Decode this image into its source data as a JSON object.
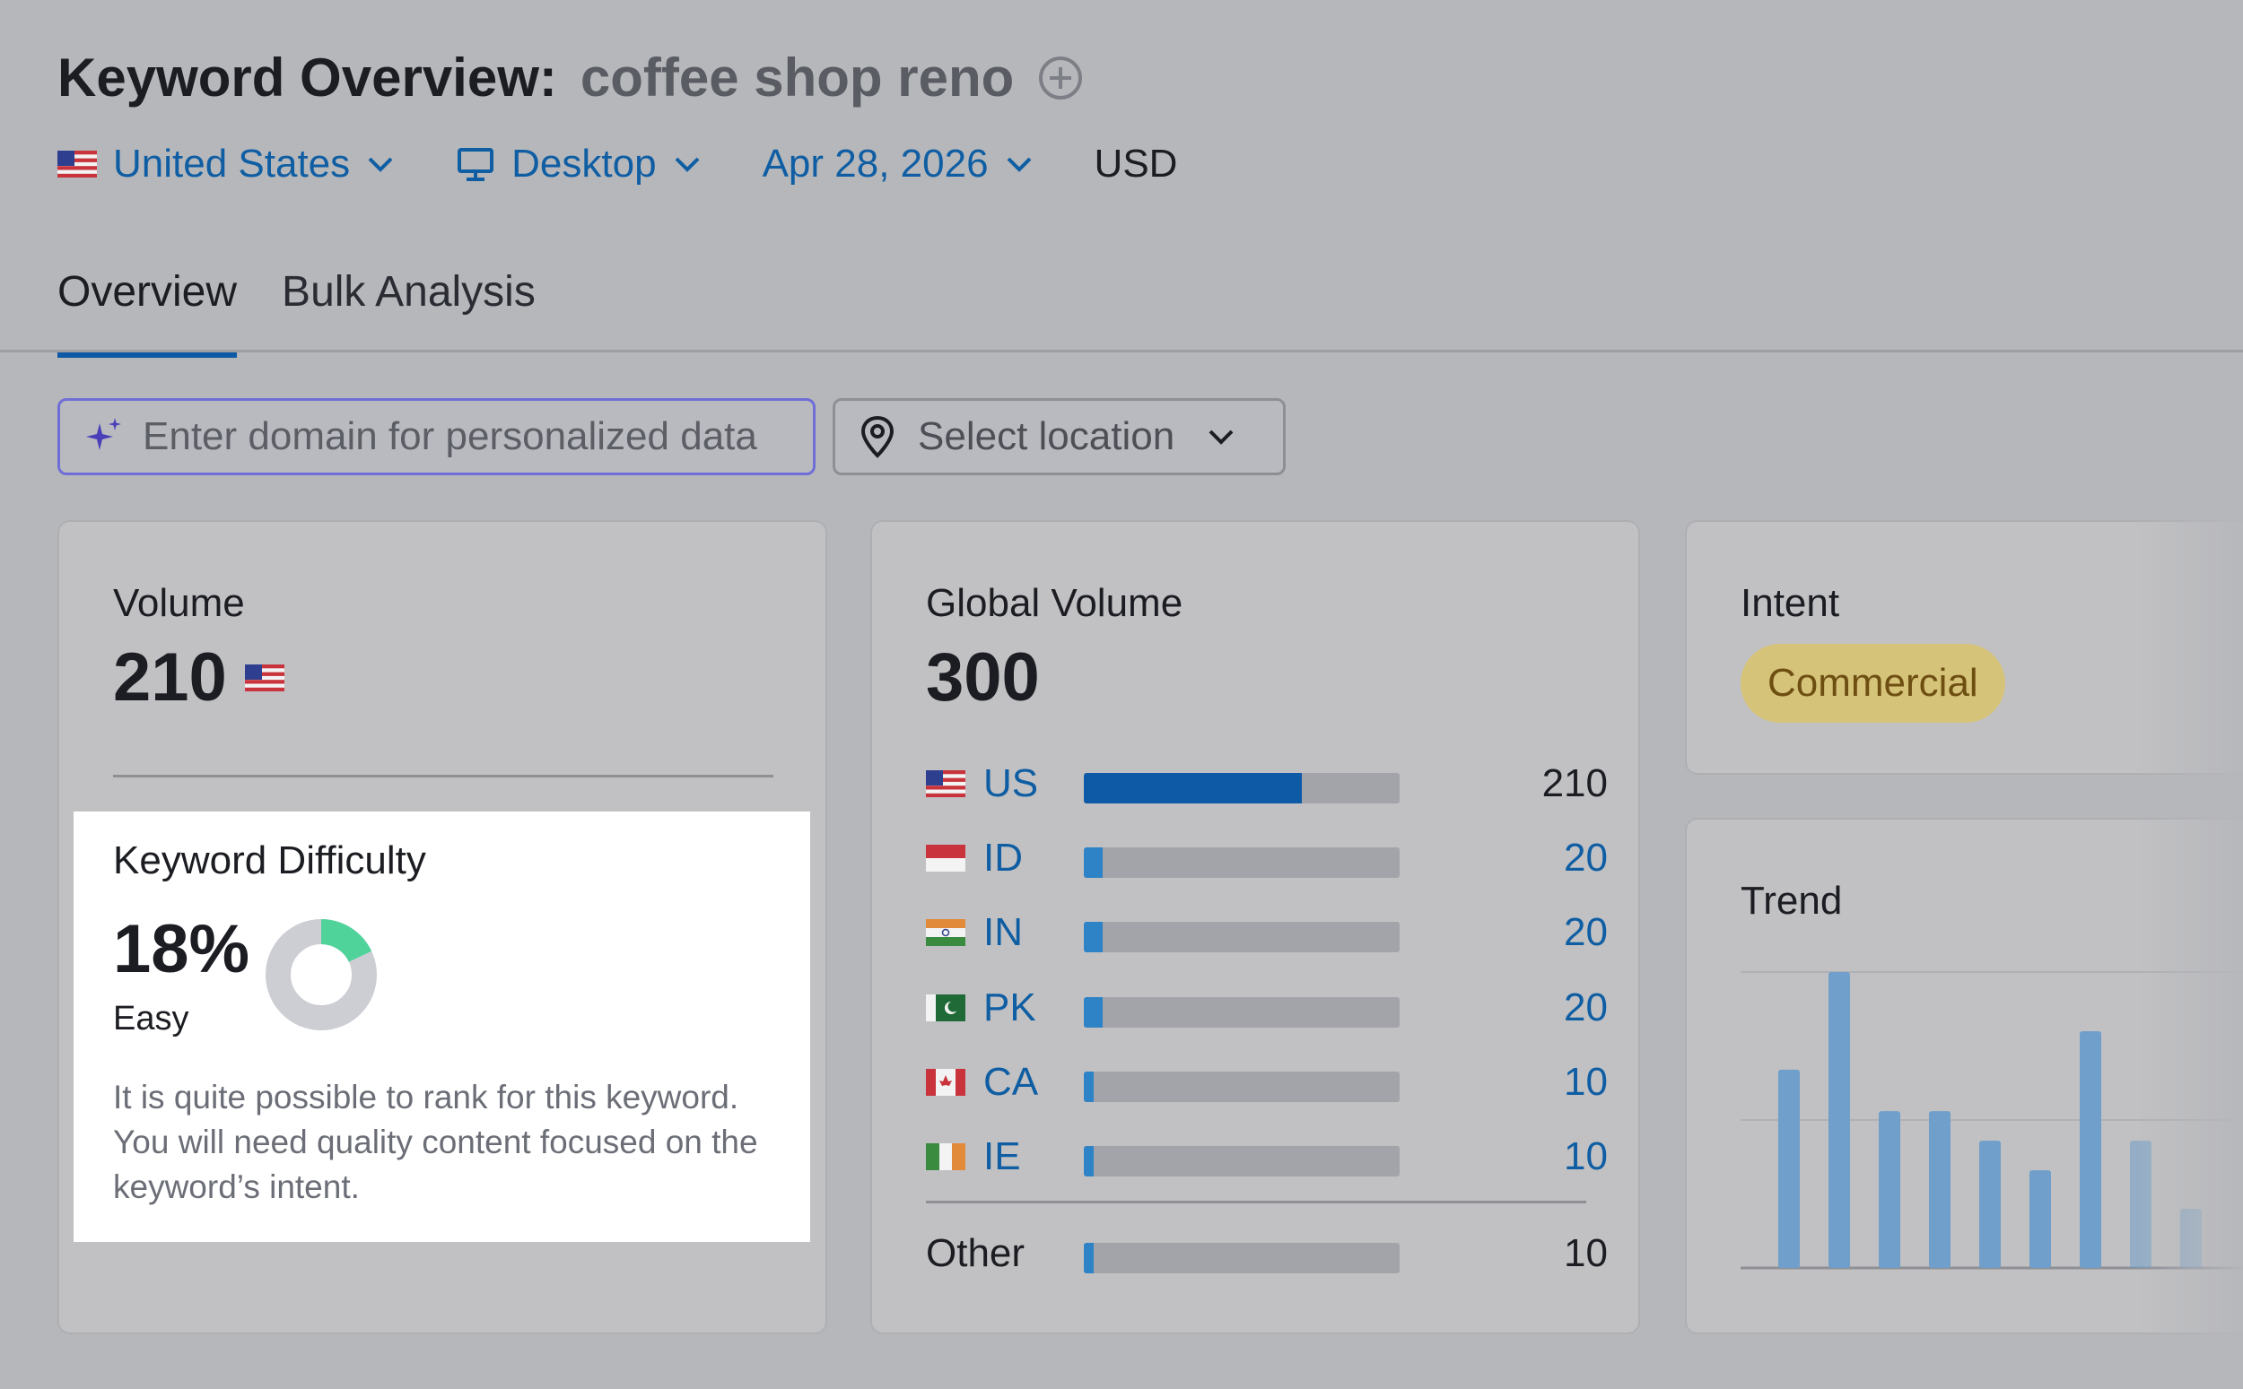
{
  "header": {
    "title": "Keyword Overview:",
    "keyword": "coffee shop reno",
    "add_icon": "plus-circle-icon"
  },
  "filters": {
    "country": "United States",
    "device": "Desktop",
    "date": "Apr 28, 2026",
    "currency": "USD"
  },
  "tabs": [
    {
      "label": "Overview",
      "active": true
    },
    {
      "label": "Bulk Analysis",
      "active": false
    }
  ],
  "search": {
    "domain_placeholder": "Enter domain for personalized data",
    "location_placeholder": "Select location"
  },
  "volume": {
    "label": "Volume",
    "value": "210"
  },
  "keyword_difficulty": {
    "label": "Keyword Difficulty",
    "value": "18%",
    "percent": 18,
    "level": "Easy",
    "description": "It is quite possible to rank for this keyword. You will need quality content focused on the keyword’s intent.",
    "color_fill": "#4fd39a",
    "color_track": "#cdced3"
  },
  "global_volume": {
    "label": "Global Volume",
    "value": "300",
    "countries": [
      {
        "code": "US",
        "value": "210",
        "fraction": 0.69
      },
      {
        "code": "ID",
        "value": "20",
        "fraction": 0.06
      },
      {
        "code": "IN",
        "value": "20",
        "fraction": 0.06
      },
      {
        "code": "PK",
        "value": "20",
        "fraction": 0.06
      },
      {
        "code": "CA",
        "value": "10",
        "fraction": 0.03
      },
      {
        "code": "IE",
        "value": "10",
        "fraction": 0.03
      }
    ],
    "other": {
      "label": "Other",
      "value": "10",
      "fraction": 0.03
    }
  },
  "intent": {
    "label": "Intent",
    "badge": "Commercial"
  },
  "trend": {
    "label": "Trend",
    "bar_color": "#6f9fca"
  },
  "chart_data": {
    "type": "bar",
    "values": [
      0.67,
      1.0,
      0.53,
      0.53,
      0.43,
      0.33,
      0.8,
      0.43,
      0.2
    ],
    "ylim": [
      0,
      1
    ],
    "grid": true
  }
}
